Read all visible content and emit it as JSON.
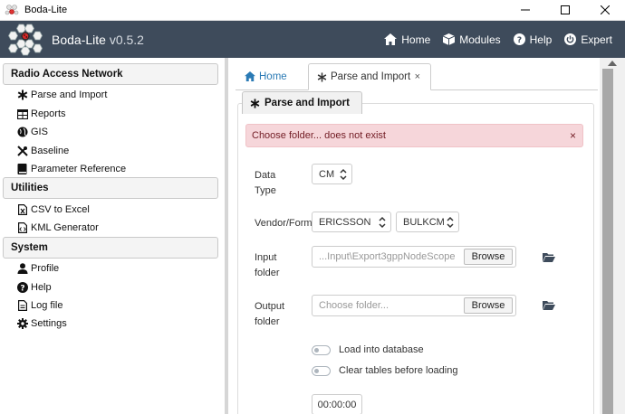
{
  "window": {
    "title": "Boda-Lite"
  },
  "navbar": {
    "brand": "Boda-Lite",
    "version": "v0.5.2",
    "links": [
      "Home",
      "Modules",
      "Help",
      "Expert"
    ]
  },
  "sidebar": {
    "sections": [
      {
        "title": "Radio Access Network",
        "items": [
          "Parse and Import",
          "Reports",
          "GIS",
          "Baseline",
          "Parameter Reference"
        ]
      },
      {
        "title": "Utilities",
        "items": [
          "CSV to Excel",
          "KML Generator"
        ]
      },
      {
        "title": "System",
        "items": [
          "Profile",
          "Help",
          "Log file",
          "Settings"
        ]
      }
    ]
  },
  "tabs": {
    "home": "Home",
    "active": "Parse and Import",
    "close": "×"
  },
  "panel": {
    "title": "Parse and Import",
    "alert": "Choose folder... does not exist",
    "alert_close": "×",
    "data_type_label_1": "Data",
    "data_type_label_2": "Type",
    "data_type_value": "CM",
    "vendor_label": "Vendor/Form",
    "vendor_value": "ERICSSON",
    "format_value": "BULKCM",
    "input_label_1": "Input",
    "input_label_2": "folder",
    "input_value": "...Input\\Export3gppNodeScope",
    "output_label_1": "Output",
    "output_label_2": "folder",
    "output_placeholder": "Choose folder...",
    "browse_label": "Browse",
    "load_db_label": "Load into database",
    "clear_tables_label": "Clear tables before loading",
    "time_value": "00:00:00"
  },
  "colors": {
    "navbar": "#3e4b5b",
    "alert_bg": "#f6d6da",
    "alert_text": "#721c24",
    "home_tab": "#2a7ab5"
  }
}
